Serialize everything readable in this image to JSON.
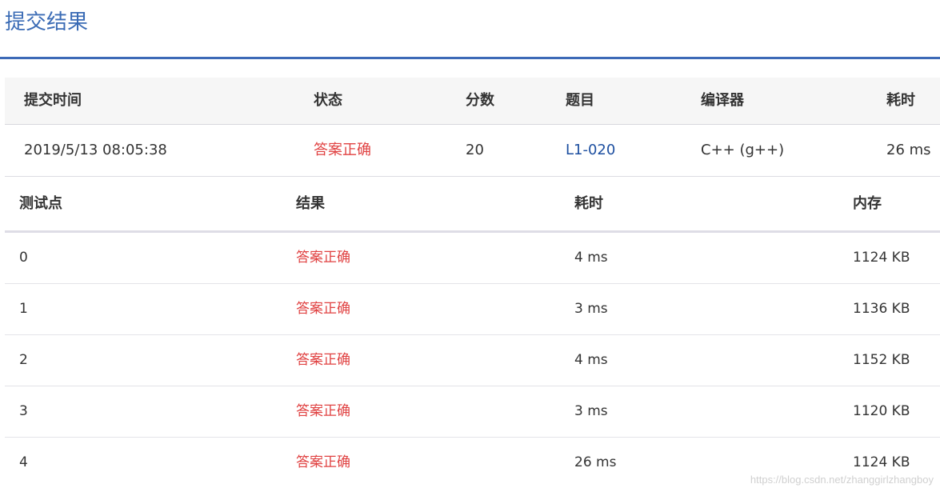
{
  "page": {
    "title": "提交结果"
  },
  "summary": {
    "headers": {
      "submit_time": "提交时间",
      "status": "状态",
      "score": "分数",
      "problem": "题目",
      "compiler": "编译器",
      "time_cost": "耗时"
    },
    "row": {
      "submit_time": "2019/5/13 08:05:38",
      "status": "答案正确",
      "score": "20",
      "problem": "L1-020",
      "compiler": "C++ (g++)",
      "time_cost": "26 ms"
    }
  },
  "cases": {
    "headers": {
      "case": "测试点",
      "result": "结果",
      "time": "耗时",
      "memory": "内存"
    },
    "rows": [
      {
        "id": "0",
        "result": "答案正确",
        "time": "4 ms",
        "memory": "1124 KB"
      },
      {
        "id": "1",
        "result": "答案正确",
        "time": "3 ms",
        "memory": "1136 KB"
      },
      {
        "id": "2",
        "result": "答案正确",
        "time": "4 ms",
        "memory": "1152 KB"
      },
      {
        "id": "3",
        "result": "答案正确",
        "time": "3 ms",
        "memory": "1120 KB"
      },
      {
        "id": "4",
        "result": "答案正确",
        "time": "26 ms",
        "memory": "1124 KB"
      }
    ]
  },
  "watermark": "https://blog.csdn.net/zhanggirlzhangboy",
  "colors": {
    "title": "#3a6bb5",
    "accepted": "#e04141",
    "link": "#1d4fa0",
    "rule": "#3d6ab7"
  }
}
